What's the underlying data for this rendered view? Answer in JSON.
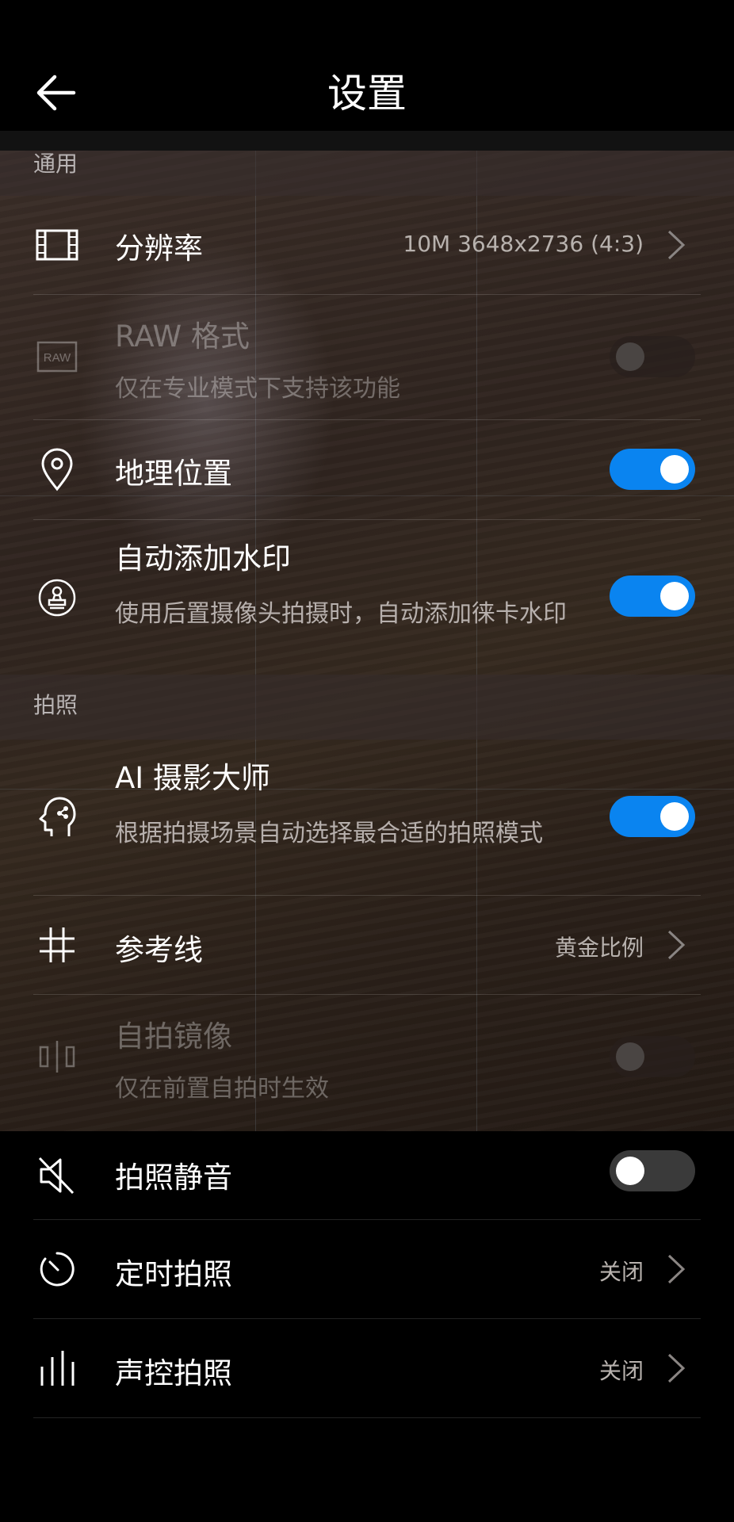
{
  "header": {
    "title": "设置"
  },
  "sections": {
    "general": "通用",
    "photo": "拍照"
  },
  "rows": {
    "resolution": {
      "label": "分辨率",
      "value": "10M 3648x2736 (4:3)"
    },
    "raw": {
      "label": "RAW 格式",
      "sub": "仅在专业模式下支持该功能",
      "toggle": "disabled"
    },
    "location": {
      "label": "地理位置",
      "toggle": "on"
    },
    "watermark": {
      "label": "自动添加水印",
      "sub": "使用后置摄像头拍摄时，自动添加徕卡水印",
      "toggle": "on"
    },
    "ai_master": {
      "label": "AI 摄影大师",
      "sub": "根据拍摄场景自动选择最合适的拍照模式",
      "toggle": "on"
    },
    "gridlines": {
      "label": "参考线",
      "value": "黄金比例"
    },
    "mirror": {
      "label": "自拍镜像",
      "sub": "仅在前置自拍时生效",
      "toggle": "disabled"
    },
    "mute": {
      "label": "拍照静音",
      "toggle": "off"
    },
    "timer": {
      "label": "定时拍照",
      "value": "关闭"
    },
    "voice": {
      "label": "声控拍照",
      "value": "关闭"
    }
  },
  "icons": {
    "back": "arrow-left-icon",
    "resolution": "film-frame-icon",
    "raw": "raw-icon",
    "location": "location-pin-icon",
    "watermark": "stamp-icon",
    "ai_master": "ai-head-icon",
    "gridlines": "grid-icon",
    "mirror": "mirror-icon",
    "mute": "speaker-muted-icon",
    "timer": "timer-icon",
    "voice": "voice-bars-icon"
  },
  "colors": {
    "accent": "#0a84f0",
    "background": "#000000"
  }
}
